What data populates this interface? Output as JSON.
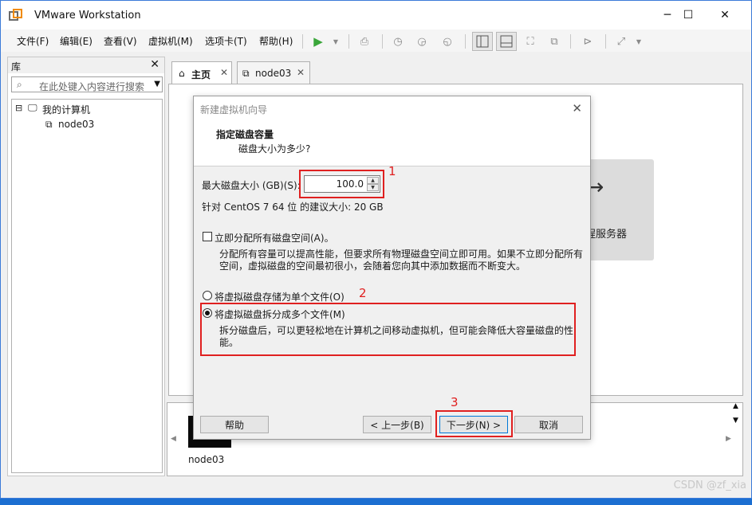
{
  "app": {
    "title": "VMware Workstation"
  },
  "window_controls": {
    "minimize": "─",
    "maximize": "☐",
    "close": "✕"
  },
  "menu": [
    "文件(F)",
    "编辑(E)",
    "查看(V)",
    "虚拟机(M)",
    "选项卡(T)",
    "帮助(H)"
  ],
  "library": {
    "title": "库",
    "close": "✕",
    "search_placeholder": "在此处键入内容进行搜索",
    "tree": {
      "root_toggle": "⊟",
      "root_label": "我的计算机",
      "child_label": "node03"
    }
  },
  "tabs": [
    {
      "label": "主页",
      "close": "✕"
    },
    {
      "label": "node03",
      "close": "✕"
    }
  ],
  "home_card": {
    "arrow": "→",
    "label": "程服务器"
  },
  "thumbnail": {
    "label": "node03"
  },
  "dialog": {
    "title": "新建虚拟机向导",
    "close": "✕",
    "heading": "指定磁盘容量",
    "subheading": "磁盘大小为多少?",
    "max_size_label": "最大磁盘大小 (GB)(S):",
    "max_size_value": "100.0",
    "recommend": "针对 CentOS 7 64 位 的建议大小: 20 GB",
    "allocate_label": "立即分配所有磁盘空间(A)。",
    "allocate_checked": false,
    "allocate_desc_1": "分配所有容量可以提高性能，但要求所有物理磁盘空间立即可用。如果不立即分配所有",
    "allocate_desc_2": "空间，虚拟磁盘的空间最初很小，会随着您向其中添加数据而不断变大。",
    "single_file_label": "将虚拟磁盘存储为单个文件(O)",
    "multi_file_label": "将虚拟磁盘拆分成多个文件(M)",
    "multi_file_desc_1": "拆分磁盘后，可以更轻松地在计算机之间移动虚拟机，但可能会降低大容量磁盘的性",
    "multi_file_desc_2": "能。",
    "selected_option": "multi",
    "buttons": {
      "help": "帮助",
      "back": "< 上一步(B)",
      "next": "下一步(N) >",
      "cancel": "取消"
    }
  },
  "annotations": [
    "1",
    "2",
    "3"
  ],
  "watermark": "CSDN @zf_xia",
  "colors": {
    "annotation": "#e02020",
    "accent": "#0078d7"
  }
}
